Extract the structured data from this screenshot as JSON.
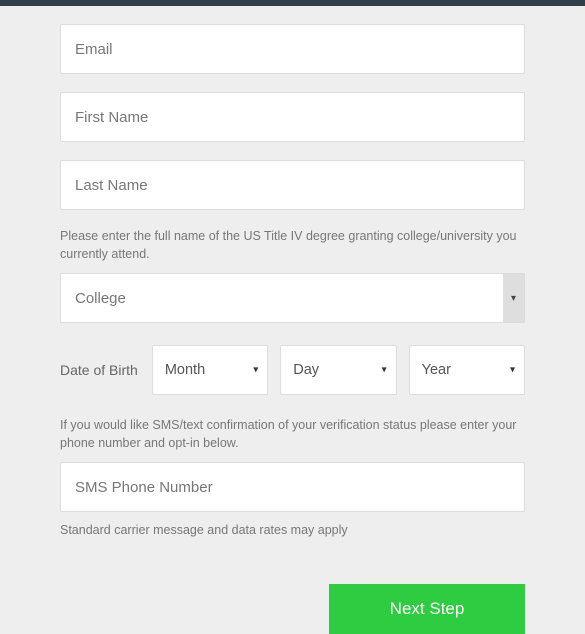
{
  "email": {
    "placeholder": "Email"
  },
  "firstName": {
    "placeholder": "First Name"
  },
  "lastName": {
    "placeholder": "Last Name"
  },
  "collegeHelper": "Please enter the full name of the US Title IV degree granting college/university you currently attend.",
  "college": {
    "placeholder": "College"
  },
  "dob": {
    "label": "Date of Birth",
    "month": "Month",
    "day": "Day",
    "year": "Year"
  },
  "smsHelper": "If you would like SMS/text confirmation of your verification status please enter your phone number and opt-in below.",
  "smsPhone": {
    "placeholder": "SMS Phone Number"
  },
  "smsDisclaimer": "Standard carrier message and data rates may apply",
  "nextButton": "Next Step"
}
